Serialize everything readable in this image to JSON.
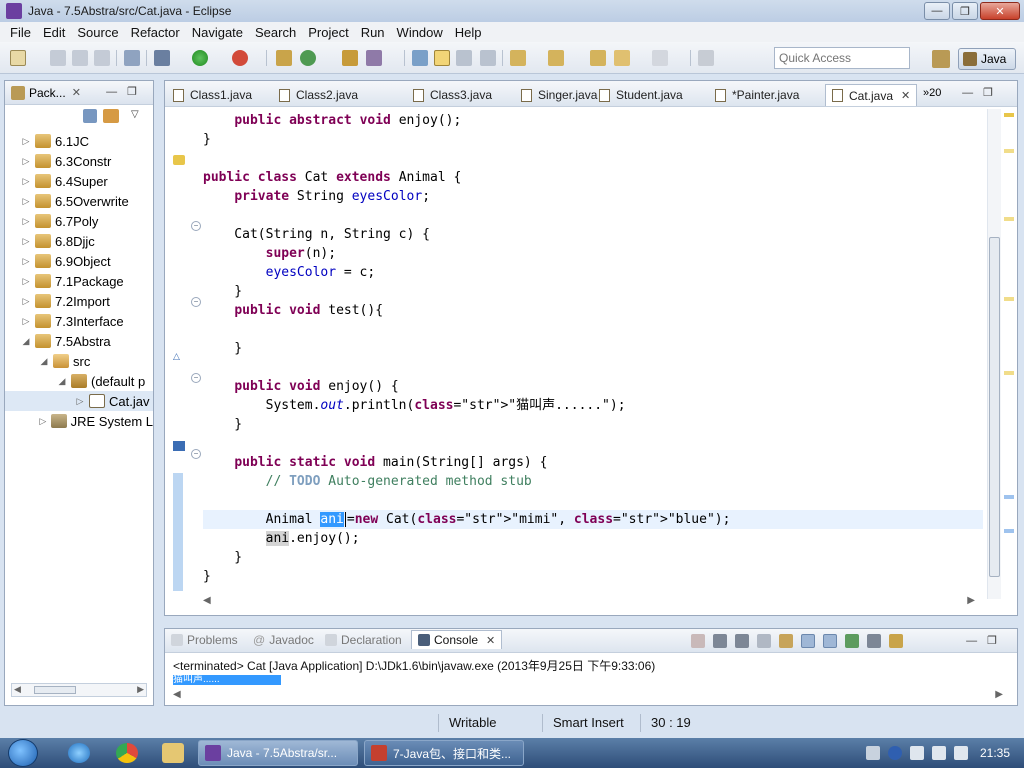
{
  "window": {
    "title": "Java - 7.5Abstra/src/Cat.java - Eclipse",
    "min_glyph": "—",
    "max_glyph": "❐",
    "close_glyph": "✕"
  },
  "menu": [
    "File",
    "Edit",
    "Source",
    "Refactor",
    "Navigate",
    "Search",
    "Project",
    "Run",
    "Window",
    "Help"
  ],
  "toolbar": {
    "quick_access_placeholder": "Quick Access",
    "perspective_label": "Java"
  },
  "package_explorer": {
    "title": "Pack...",
    "close_glyph": "✕",
    "tree": [
      {
        "label": "6.1JC",
        "twisty": "▷",
        "indent": 0,
        "icon": "project-icon"
      },
      {
        "label": "6.3Constr",
        "twisty": "▷",
        "indent": 0,
        "icon": "project-icon"
      },
      {
        "label": "6.4Super",
        "twisty": "▷",
        "indent": 0,
        "icon": "project-icon"
      },
      {
        "label": "6.5Overwrite",
        "twisty": "▷",
        "indent": 0,
        "icon": "project-icon"
      },
      {
        "label": "6.7Poly",
        "twisty": "▷",
        "indent": 0,
        "icon": "project-icon"
      },
      {
        "label": "6.8Djjc",
        "twisty": "▷",
        "indent": 0,
        "icon": "project-icon"
      },
      {
        "label": "6.9Object",
        "twisty": "▷",
        "indent": 0,
        "icon": "project-icon"
      },
      {
        "label": "7.1Package",
        "twisty": "▷",
        "indent": 0,
        "icon": "project-icon"
      },
      {
        "label": "7.2Import",
        "twisty": "▷",
        "indent": 0,
        "icon": "project-icon"
      },
      {
        "label": "7.3Interface",
        "twisty": "▷",
        "indent": 0,
        "icon": "project-icon"
      },
      {
        "label": "7.5Abstra",
        "twisty": "◢",
        "indent": 0,
        "icon": "project-icon"
      },
      {
        "label": "src",
        "twisty": "◢",
        "indent": 1,
        "icon": "source-folder-icon"
      },
      {
        "label": "(default p",
        "twisty": "◢",
        "indent": 2,
        "icon": "package-icon"
      },
      {
        "label": "Cat.jav",
        "twisty": "▷",
        "indent": 3,
        "icon": "java-file-icon",
        "selected": true
      },
      {
        "label": "JRE System L",
        "twisty": "▷",
        "indent": 1,
        "icon": "jre-library-icon"
      }
    ]
  },
  "editor": {
    "tabs": [
      {
        "label": "Class1.java"
      },
      {
        "label": "Class2.java"
      },
      {
        "label": "Class3.java"
      },
      {
        "label": "Singer.java"
      },
      {
        "label": "Student.java"
      },
      {
        "label": "*Painter.java"
      },
      {
        "label": "Cat.java",
        "active": true
      }
    ],
    "tab_close_glyph": "✕",
    "more_tabs": "»20",
    "code_lines": [
      "    public abstract void enjoy();",
      "}",
      "",
      "public class Cat extends Animal {",
      "    private String eyesColor;",
      "",
      "    Cat(String n, String c) {",
      "        super(n);",
      "        eyesColor = c;",
      "    }",
      "    public void test(){",
      "",
      "    }",
      "",
      "    public void enjoy() {",
      "        System.out.println(\"猫叫声......\");",
      "    }",
      "",
      "    public static void main(String[] args) {",
      "        // TODO Auto-generated method stub",
      "",
      "        Animal ani=new Cat(\"mimi\", \"blue\");",
      "        ani.enjoy();",
      "    }",
      "}"
    ]
  },
  "console": {
    "tabs": [
      {
        "label": "Problems",
        "icon": "problems-icon"
      },
      {
        "label": "Javadoc",
        "icon": "javadoc-icon"
      },
      {
        "label": "Declaration",
        "icon": "declaration-icon"
      },
      {
        "label": "Console",
        "icon": "console-icon",
        "active": true
      }
    ],
    "status": "<terminated> Cat [Java Application] D:\\JDk1.6\\bin\\javaw.exe (2013年9月25日 下午9:33:06)",
    "output": "猫叫声......"
  },
  "statusbar": {
    "writable": "Writable",
    "insert_mode": "Smart Insert",
    "position": "30 : 19"
  },
  "taskbar": {
    "tasks": [
      {
        "label": "Java - 7.5Abstra/sr...",
        "active": true
      },
      {
        "label": "7-Java包、接口和类...",
        "active": false
      }
    ],
    "clock": "21:35"
  },
  "colors": {
    "keyword": "#7f0055",
    "field": "#0000c0",
    "string": "#2a00ff",
    "comment": "#3f7f5f",
    "selection": "#3399ff"
  }
}
